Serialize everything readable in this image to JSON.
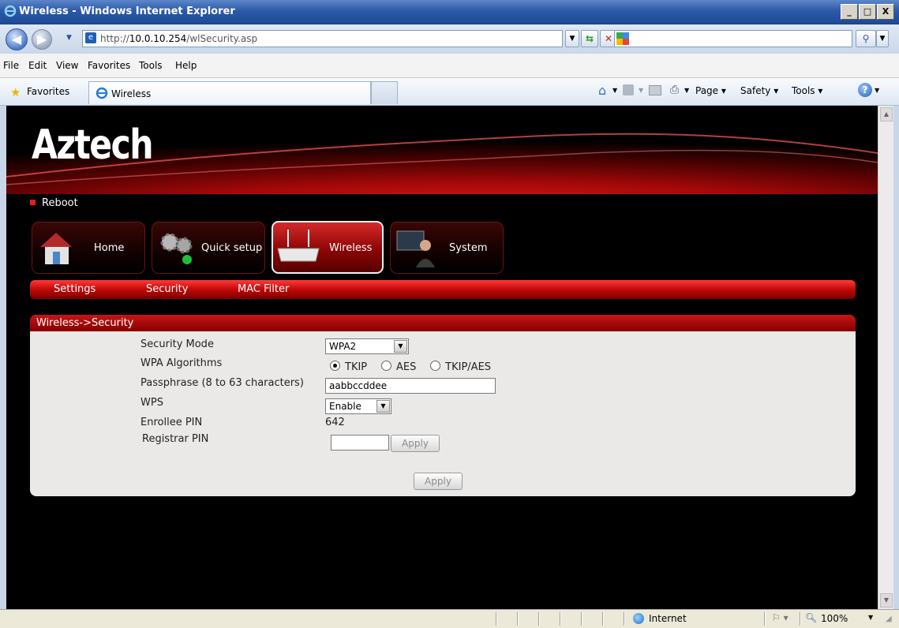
{
  "window": {
    "title": "Wireless - Windows Internet Explorer",
    "buttons": [
      "_",
      "□",
      "X"
    ]
  },
  "address": {
    "url_prefix": "http://",
    "url_host": "10.0.10.254",
    "url_path": "/wlSecurity.asp"
  },
  "menu": [
    "File",
    "Edit",
    "View",
    "Favorites",
    "Tools",
    "Help"
  ],
  "favorites_bar": {
    "favorites_label": "Favorites",
    "tab_label": "Wireless",
    "commands": [
      "Page ▾",
      "Safety ▾",
      "Tools ▾"
    ]
  },
  "page": {
    "logo": "Aztech",
    "reboot": "Reboot",
    "nav": [
      {
        "label": "Home",
        "active": false
      },
      {
        "label": "Quick setup",
        "active": false
      },
      {
        "label": "Wireless",
        "active": true
      },
      {
        "label": "System",
        "active": false
      }
    ],
    "subnav": [
      "Settings",
      "Security",
      "MAC Filter"
    ],
    "panel_title": "Wireless->Security",
    "form": {
      "security_mode_label": "Security Mode",
      "security_mode_value": "WPA2",
      "wpa_algorithms_label": "WPA Algorithms",
      "algorithms": [
        {
          "label": "TKIP",
          "checked": true
        },
        {
          "label": "AES",
          "checked": false
        },
        {
          "label": "TKIP/AES",
          "checked": false
        }
      ],
      "passphrase_label": "Passphrase (8 to 63 characters)",
      "passphrase_value": "aabbccddee",
      "wps_label": "WPS",
      "wps_value": "Enable",
      "enrollee_pin_label": "Enrollee PIN",
      "enrollee_pin_value": "642",
      "registrar_pin_label": "Registrar PIN",
      "registrar_pin_value": "",
      "apply_small": "Apply",
      "apply_main": "Apply"
    }
  },
  "status": {
    "zone": "Internet",
    "zoom": "100%"
  },
  "colors": {
    "brand_red": "#c10808",
    "ie_title_blue": "#2d5aa8"
  }
}
